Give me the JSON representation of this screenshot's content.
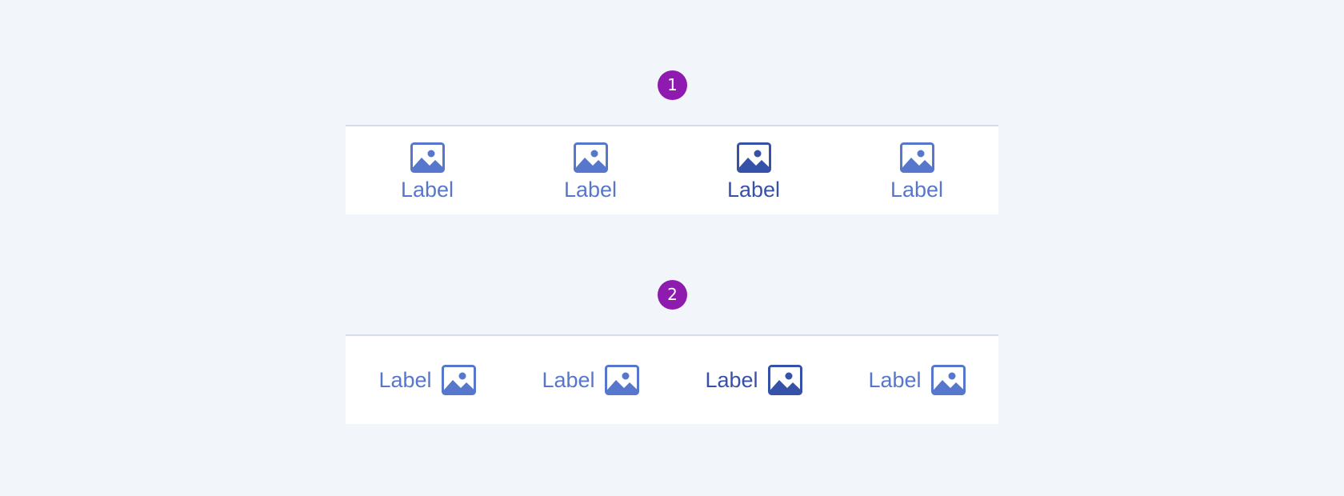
{
  "badges": [
    "1",
    "2"
  ],
  "tab_bar_vertical": {
    "tabs": [
      {
        "label": "Label",
        "icon": "image-icon",
        "active": false
      },
      {
        "label": "Label",
        "icon": "image-icon",
        "active": false
      },
      {
        "label": "Label",
        "icon": "image-icon",
        "active": true
      },
      {
        "label": "Label",
        "icon": "image-icon",
        "active": false
      }
    ]
  },
  "tab_bar_horizontal": {
    "tabs": [
      {
        "label": "Label",
        "icon": "image-icon",
        "active": false
      },
      {
        "label": "Label",
        "icon": "image-icon",
        "active": false
      },
      {
        "label": "Label",
        "icon": "image-icon",
        "active": true
      },
      {
        "label": "Label",
        "icon": "image-icon",
        "active": false
      }
    ]
  },
  "colors": {
    "background": "#f2f5f9",
    "badge": "#8e1ab0",
    "tab_default": "#5677cc",
    "tab_active": "#3651a8",
    "bar_border": "#d3dcf0"
  }
}
